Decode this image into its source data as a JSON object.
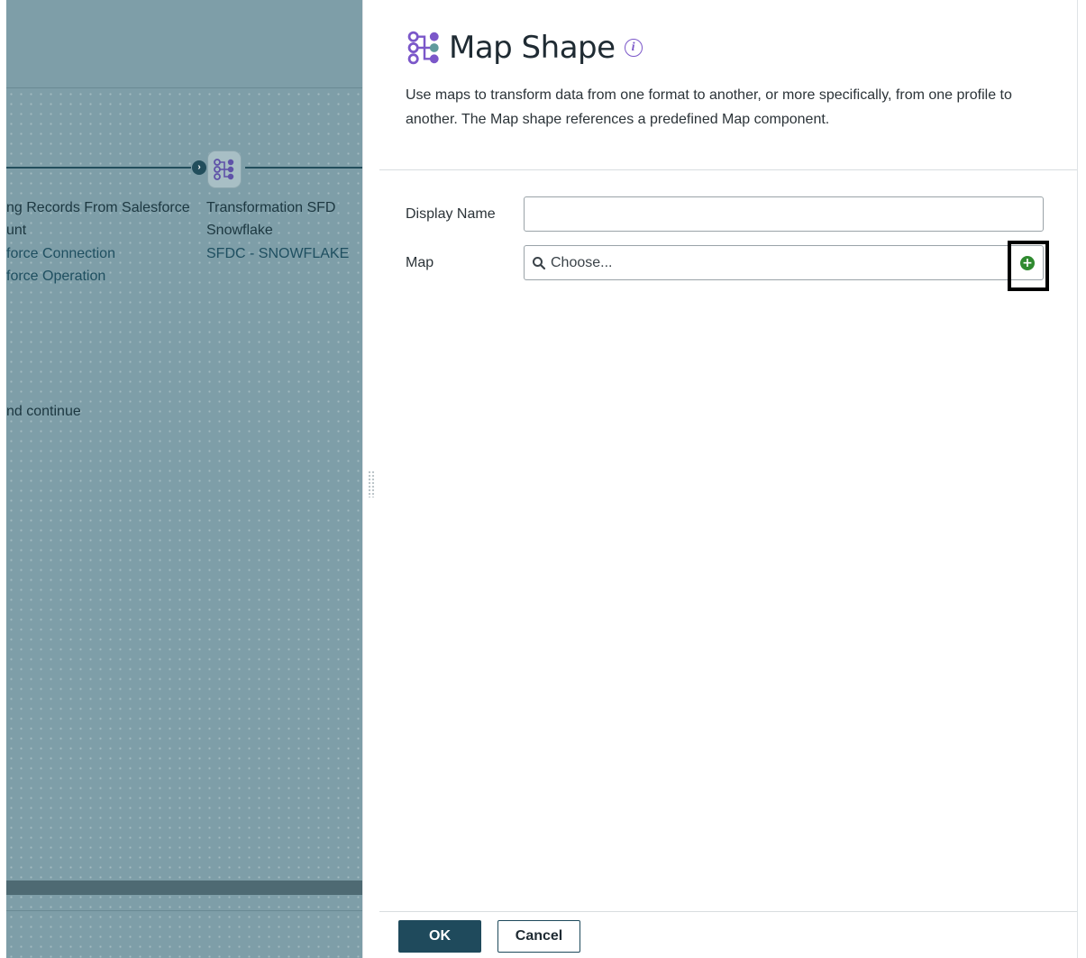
{
  "canvas": {
    "step_previous": {
      "title": "ng Records From Salesforce",
      "subtitle": "unt",
      "connection": "force Connection",
      "operation": "force Operation"
    },
    "step_map": {
      "title": "Transformation SFD",
      "subtitle": "Snowflake",
      "map_name": "SFDC - SNOWFLAKE"
    },
    "branch_label": "nd continue"
  },
  "panel": {
    "title": "Map Shape",
    "description": "Use maps to transform data from one format to another, or more specifically, from one profile to another. The Map shape references a predefined Map component.",
    "fields": {
      "display_name": {
        "label": "Display Name",
        "value": ""
      },
      "map": {
        "label": "Map",
        "placeholder": "Choose..."
      }
    },
    "buttons": {
      "ok": "OK",
      "cancel": "Cancel"
    }
  },
  "icons": {
    "title": "map-shape-icon",
    "info": "info-icon",
    "search": "search-icon",
    "add": "add-icon"
  },
  "colors": {
    "accent_purple": "#7b57c9",
    "primary_button": "#1f4a5c",
    "add_green": "#2f8a2f",
    "canvas_overlay": "#7e9ea8"
  }
}
